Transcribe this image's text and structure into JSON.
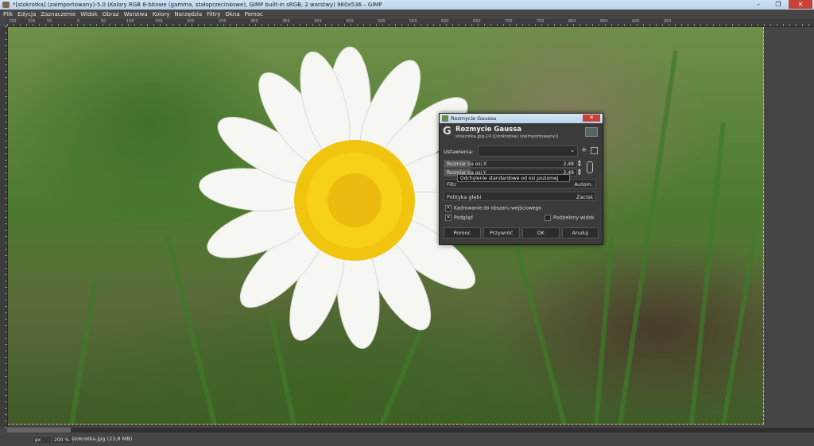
{
  "window": {
    "title": "*[stokrotka] (zaimportowany)-5.0 (Kolory RGB 8-bitowe (gamma, stałoprzecinkowe), GIMP built-in sRGB, 2 warstwy) 960x536 – GIMP",
    "btn_min": "–",
    "btn_max": "❐",
    "btn_close": "✕"
  },
  "menu": [
    "Plik",
    "Edycja",
    "Zaznaczenie",
    "Widok",
    "Obraz",
    "Warstwa",
    "Kolory",
    "Narzędzia",
    "Filtry",
    "Okna",
    "Pomoc"
  ],
  "ruler_top": [
    "150",
    "100",
    "50",
    "0",
    "50",
    "100",
    "150",
    "200",
    "250",
    "300",
    "350",
    "400",
    "450",
    "500",
    "550",
    "600",
    "650",
    "700",
    "750",
    "800",
    "850",
    "900",
    "950"
  ],
  "dialog": {
    "titlebar": "Rozmycie Gaussa",
    "close": "✕",
    "g_icon": "G",
    "title": "Rozmycie Gaussa",
    "subtitle": "stokrotka.jpg-10 ([stokrotka] (zaimportowany))",
    "presets_label": "Ustawienia:",
    "presets_chev": "⌄",
    "add_icon": "+",
    "size_x_label": "Rozmiar na osi X",
    "size_x_value": "2,48",
    "size_y_label": "Rozmiar na osi Y",
    "size_y_value": "2,48",
    "tooltip": "Odchylenie standardowe od osi poziomej",
    "filter_label": "Filtr",
    "filter_value": "Autom.",
    "abyss_label": "Polityka głębi",
    "abyss_value": "Zacisk",
    "clip_label": "Kadrowanie do obszaru wejściowego",
    "preview_label": "Podgląd",
    "split_label": "Podzielony widok",
    "check_mark": "✕",
    "buttons": {
      "help": "Pomoc",
      "reset": "Przywróć",
      "ok": "OK",
      "cancel": "Anuluj"
    }
  },
  "status": {
    "unit": "px",
    "zoom": "200 %",
    "file": "stokrotka.jpg (23,8 MB)"
  }
}
